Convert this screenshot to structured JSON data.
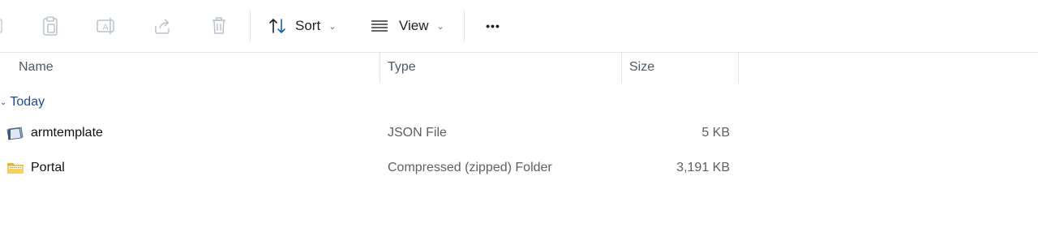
{
  "toolbar": {
    "copy_icon": "copy-icon",
    "paste_icon": "paste-icon",
    "rename_icon": "rename-icon",
    "share_icon": "share-icon",
    "delete_icon": "delete-icon",
    "sort_label": "Sort",
    "view_label": "View",
    "more_label": "•••"
  },
  "columns": {
    "name": "Name",
    "type": "Type",
    "size": "Size"
  },
  "group": {
    "label": "Today"
  },
  "files": [
    {
      "name": "armtemplate",
      "type": "JSON File",
      "size": "5 KB",
      "icon": "json-file-icon"
    },
    {
      "name": "Portal",
      "type": "Compressed (zipped) Folder",
      "size": "3,191 KB",
      "icon": "zip-folder-icon"
    }
  ],
  "colors": {
    "accent": "#1d4a9a",
    "sort_arrow": "#1a5fb4",
    "muted_icon": "#b9c2cc"
  }
}
